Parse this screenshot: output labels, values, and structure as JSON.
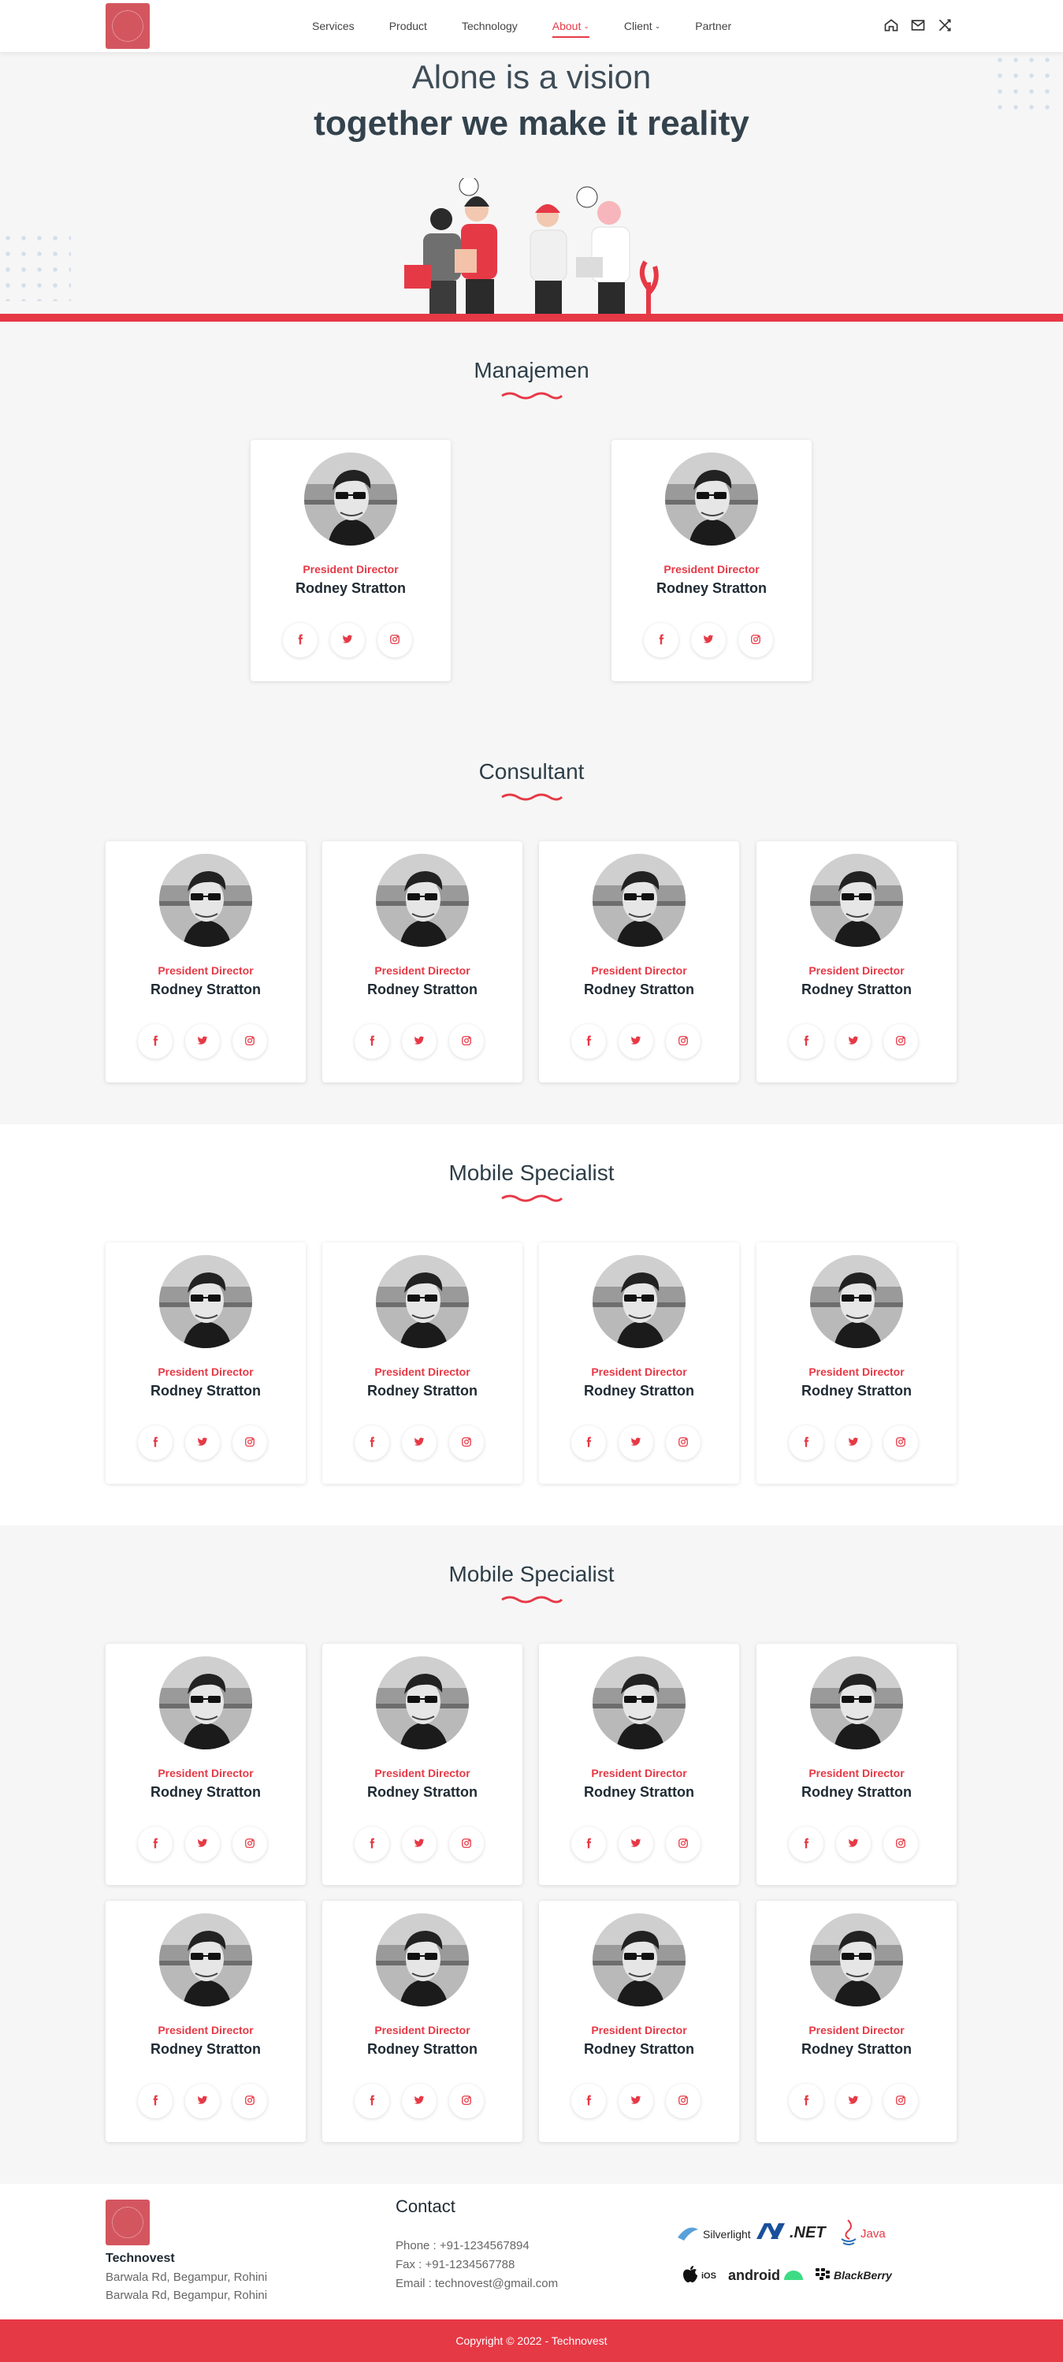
{
  "nav": {
    "items": [
      {
        "label": "Services",
        "dropdown": false,
        "active": false
      },
      {
        "label": "Product",
        "dropdown": false,
        "active": false
      },
      {
        "label": "Technology",
        "dropdown": false,
        "active": false
      },
      {
        "label": "About",
        "dropdown": true,
        "active": true
      },
      {
        "label": "Client",
        "dropdown": true,
        "active": false
      },
      {
        "label": "Partner",
        "dropdown": false,
        "active": false
      }
    ],
    "icons": [
      "home-icon",
      "mail-icon",
      "shuffle-icon"
    ]
  },
  "hero": {
    "line1": "Alone is a vision",
    "line2": "together we make it reality"
  },
  "accent_color": "#e63946",
  "sections": [
    {
      "title": "Manajemen",
      "members": [
        {
          "role": "President Director",
          "name": "Rodney Stratton"
        },
        {
          "role": "President Director",
          "name": "Rodney Stratton"
        }
      ]
    },
    {
      "title": "Consultant",
      "members": [
        {
          "role": "President Director",
          "name": "Rodney Stratton"
        },
        {
          "role": "President Director",
          "name": "Rodney Stratton"
        },
        {
          "role": "President Director",
          "name": "Rodney Stratton"
        },
        {
          "role": "President Director",
          "name": "Rodney Stratton"
        }
      ]
    },
    {
      "title": "Mobile Specialist",
      "members": [
        {
          "role": "President Director",
          "name": "Rodney Stratton"
        },
        {
          "role": "President Director",
          "name": "Rodney Stratton"
        },
        {
          "role": "President Director",
          "name": "Rodney Stratton"
        },
        {
          "role": "President Director",
          "name": "Rodney Stratton"
        }
      ]
    },
    {
      "title": "Mobile Specialist",
      "members": [
        {
          "role": "President Director",
          "name": "Rodney Stratton"
        },
        {
          "role": "President Director",
          "name": "Rodney Stratton"
        },
        {
          "role": "President Director",
          "name": "Rodney Stratton"
        },
        {
          "role": "President Director",
          "name": "Rodney Stratton"
        },
        {
          "role": "President Director",
          "name": "Rodney Stratton"
        },
        {
          "role": "President Director",
          "name": "Rodney Stratton"
        },
        {
          "role": "President Director",
          "name": "Rodney Stratton"
        },
        {
          "role": "President Director",
          "name": "Rodney Stratton"
        }
      ]
    }
  ],
  "social_icons": [
    "facebook-icon",
    "twitter-icon",
    "instagram-icon"
  ],
  "footer": {
    "company": "Technovest",
    "address1": "Barwala Rd, Begampur, Rohini",
    "address2": "Barwala Rd, Begampur, Rohini",
    "contact_title": "Contact",
    "phone": "Phone : +91-1234567894",
    "fax": "Fax : +91-1234567788",
    "email": "Email : technovest@gmail.com",
    "technologies": [
      {
        "label": "Silverlight",
        "icon": "silverlight-icon"
      },
      {
        "label": ".NET",
        "icon": "dotnet-icon"
      },
      {
        "label": "Java",
        "icon": "java-icon"
      },
      {
        "label": "iOS",
        "icon": "apple-icon"
      },
      {
        "label": "android",
        "icon": "android-icon"
      },
      {
        "label": "BlackBerry",
        "icon": "blackberry-icon"
      }
    ],
    "copyright": "Copyright © 2022 - Technovest"
  }
}
